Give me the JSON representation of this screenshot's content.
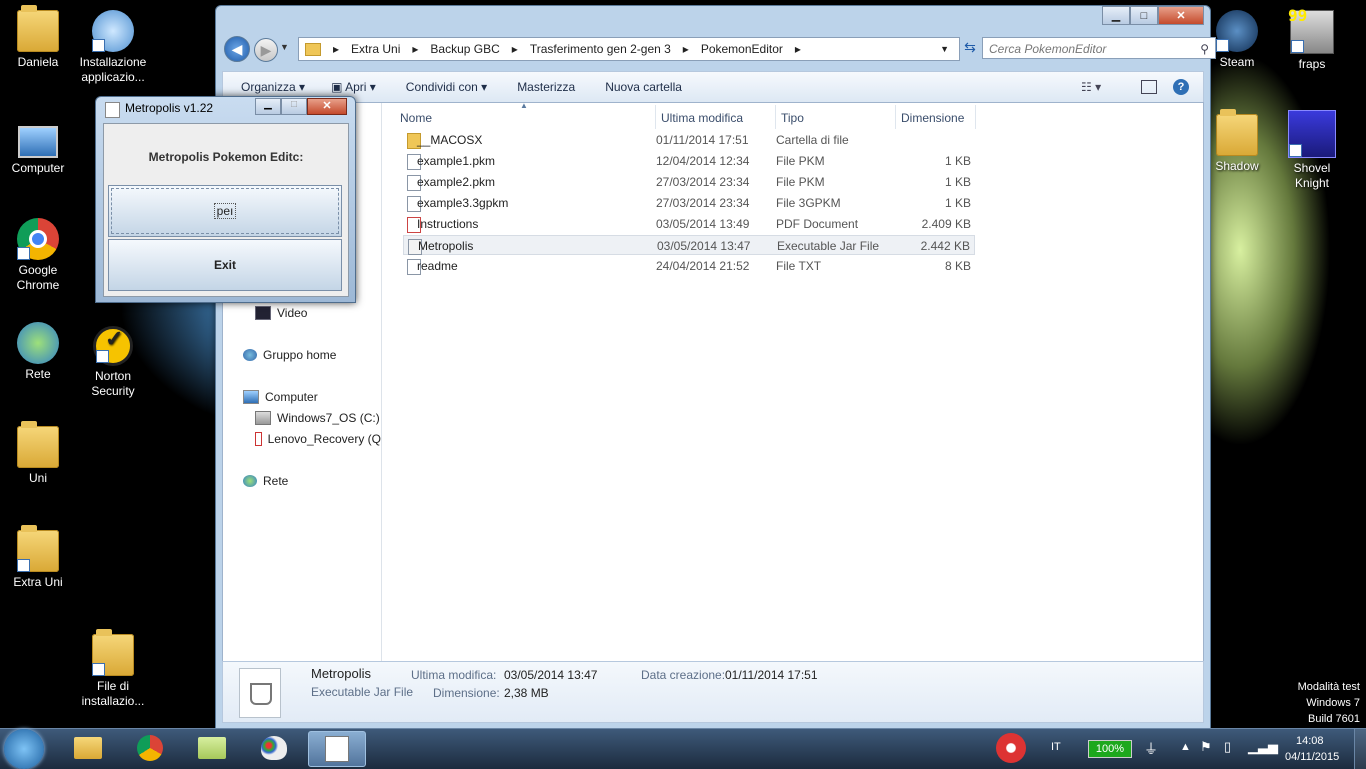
{
  "desktop_left": [
    {
      "label": "Daniela",
      "icon": "user-folder-icon"
    },
    {
      "label": "Installazione applicazio...",
      "icon": "installer-icon"
    },
    {
      "label": "Computer",
      "icon": "computer-icon"
    },
    {
      "label": "Google Chrome",
      "icon": "chrome-icon"
    },
    {
      "label": "Rete",
      "icon": "network-icon"
    },
    {
      "label": "Norton Security",
      "icon": "norton-icon"
    },
    {
      "label": "Uni",
      "icon": "folder-icon"
    },
    {
      "label": "Extra Uni",
      "icon": "folder-icon"
    },
    {
      "label": "File di installazio...",
      "icon": "folder-icon"
    }
  ],
  "desktop_right": [
    {
      "label": "Steam",
      "icon": "steam-icon"
    },
    {
      "label": "fraps",
      "icon": "fraps-icon"
    },
    {
      "label": "Shadow",
      "icon": "folder-icon"
    },
    {
      "label": "Shovel Knight",
      "icon": "shovel-knight-icon"
    }
  ],
  "fraps_counter": "99",
  "explorer": {
    "breadcrumb": [
      "Extra Uni",
      "Backup GBC",
      "Trasferimento gen 2-gen 3",
      "PokemonEditor"
    ],
    "search_placeholder": "Cerca PokemonEditor",
    "commands": [
      "Organizza",
      "Apri",
      "Condividi con",
      "Masterizza",
      "Nuova cartella"
    ],
    "nav": {
      "video": "Video",
      "homegroup": "Gruppo home",
      "computer": "Computer",
      "drive_c": "Windows7_OS (C:)",
      "drive_recovery": "Lenovo_Recovery (Q",
      "network": "Rete"
    },
    "columns": [
      "Nome",
      "Ultima modifica",
      "Tipo",
      "Dimensione"
    ],
    "files": [
      {
        "name": "__MACOSX",
        "date": "01/11/2014 17:51",
        "type": "Cartella di file",
        "size": "",
        "icon": "folder"
      },
      {
        "name": "example1.pkm",
        "date": "12/04/2014 12:34",
        "type": "File PKM",
        "size": "1 KB",
        "icon": "file"
      },
      {
        "name": "example2.pkm",
        "date": "27/03/2014 23:34",
        "type": "File PKM",
        "size": "1 KB",
        "icon": "file"
      },
      {
        "name": "example3.3gpkm",
        "date": "27/03/2014 23:34",
        "type": "File 3GPKM",
        "size": "1 KB",
        "icon": "file"
      },
      {
        "name": "Instructions",
        "date": "03/05/2014 13:49",
        "type": "PDF Document",
        "size": "2.409 KB",
        "icon": "pdf"
      },
      {
        "name": "Metropolis",
        "date": "03/05/2014 13:47",
        "type": "Executable Jar File",
        "size": "2.442 KB",
        "icon": "jar"
      },
      {
        "name": "readme",
        "date": "24/04/2014 21:52",
        "type": "File TXT",
        "size": "8 KB",
        "icon": "file"
      }
    ],
    "details": {
      "name": "Metropolis",
      "type": "Executable Jar File",
      "modified_label": "Ultima modifica:",
      "modified_value": "03/05/2014 13:47",
      "created_label": "Data creazione:",
      "created_value": "01/11/2014 17:51",
      "size_label": "Dimensione:",
      "size_value": "2,38 MB"
    }
  },
  "metro_dialog": {
    "title": "Metropolis v1.22",
    "heading": "Metropolis Pokemon Editc:",
    "open_button": "peı",
    "exit_button": "Exit"
  },
  "taskbar": {
    "lang": "IT",
    "battery": "100%",
    "time": "14:08",
    "date": "04/11/2015"
  },
  "watermark": [
    "Modalità test",
    "Windows 7",
    "Build 7601"
  ]
}
